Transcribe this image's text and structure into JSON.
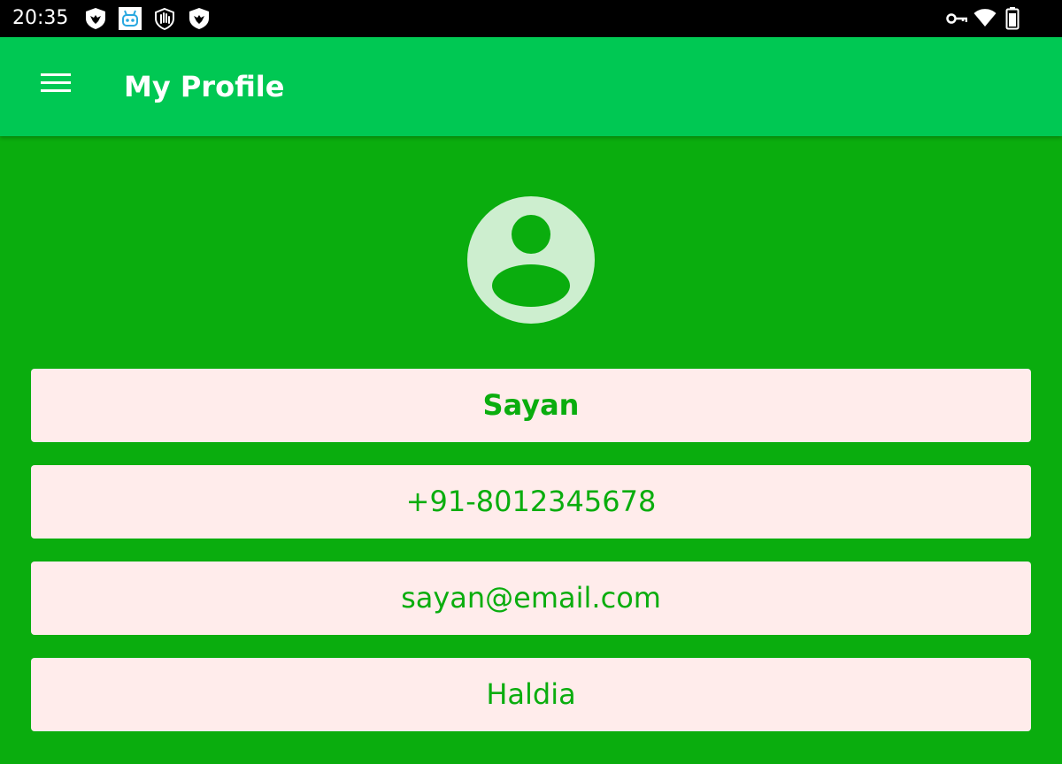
{
  "status_bar": {
    "time": "20:35",
    "notification_icons": [
      "shield-bird-icon",
      "robot-icon",
      "hand-shield-icon",
      "shield-bird-icon"
    ],
    "system_icons": [
      "vpn-key-icon",
      "wifi-icon",
      "battery-icon"
    ]
  },
  "app_bar": {
    "title": "My Profile",
    "menu_icon": "hamburger-menu-icon"
  },
  "profile": {
    "avatar_icon": "account-circle-icon",
    "name": "Sayan",
    "phone": "+91-8012345678",
    "email": "sayan@email.com",
    "city": "Haldia"
  },
  "colors": {
    "background": "#0aad0e",
    "app_bar": "#00c853",
    "field_background": "#ffeceb",
    "field_text": "#0aad0e",
    "avatar": "#cdeecf"
  }
}
